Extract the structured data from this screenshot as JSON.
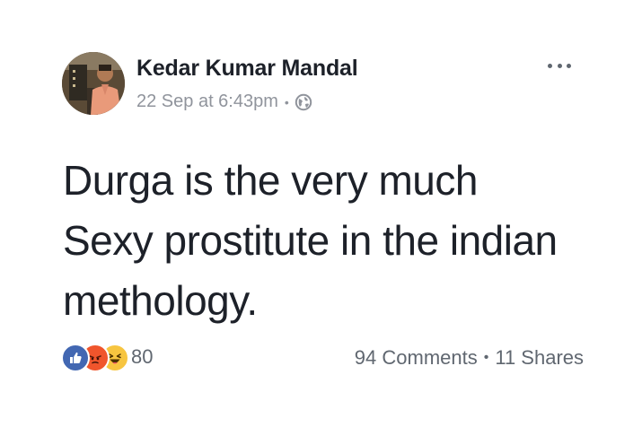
{
  "author": {
    "name": "Kedar Kumar Mandal",
    "timestamp": "22 Sep at 6:43pm",
    "separator": "•",
    "privacy_icon": "globe-icon"
  },
  "post": {
    "text_lines": [
      "Durga is the very much",
      "Sexy prostitute in the indian",
      "methology."
    ]
  },
  "footer": {
    "reaction_icons": [
      "like-icon",
      "angry-icon",
      "haha-icon"
    ],
    "reaction_count": "80",
    "comments": "94 Comments",
    "separator": "•",
    "shares": "11 Shares"
  },
  "colors": {
    "name": "#1d2129",
    "meta": "#90949c",
    "footer": "#606770",
    "like": "#4267b2",
    "angry": "#f0552c",
    "haha": "#f7c540"
  }
}
